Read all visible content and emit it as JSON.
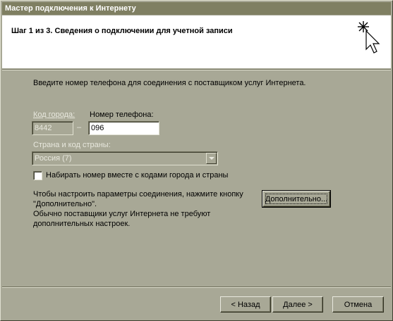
{
  "window": {
    "title": "Мастер подключения к Интернету"
  },
  "header": {
    "step_title": "Шаг 1 из 3. Сведения о подключении для учетной записи"
  },
  "intro": "Введите номер телефона для соединения с поставщиком услуг Интернета.",
  "area_code": {
    "label": "Код города:",
    "value": "8442"
  },
  "dash": "–",
  "phone": {
    "label": "Номер телефона:",
    "value": "096"
  },
  "country": {
    "label": "Страна и код страны:",
    "value": "Россия (7)"
  },
  "dial_checkbox": {
    "label": "Набирать номер вместе с кодами города и страны",
    "checked": false
  },
  "advanced": {
    "text_line1": "Чтобы настроить параметры соединения, нажмите кнопку",
    "text_line2": "\"Дополнительно\".",
    "text_line3": "Обычно поставщики услуг Интернета не требуют",
    "text_line4": "дополнительных настроек.",
    "button_label": "Дополнительно..."
  },
  "buttons": {
    "back": "< Назад",
    "next": "Далее >",
    "cancel": "Отмена"
  },
  "icons": {
    "header_icon": "wizard-sparkle-cursor-icon",
    "combo_arrow": "chevron-down-icon"
  }
}
